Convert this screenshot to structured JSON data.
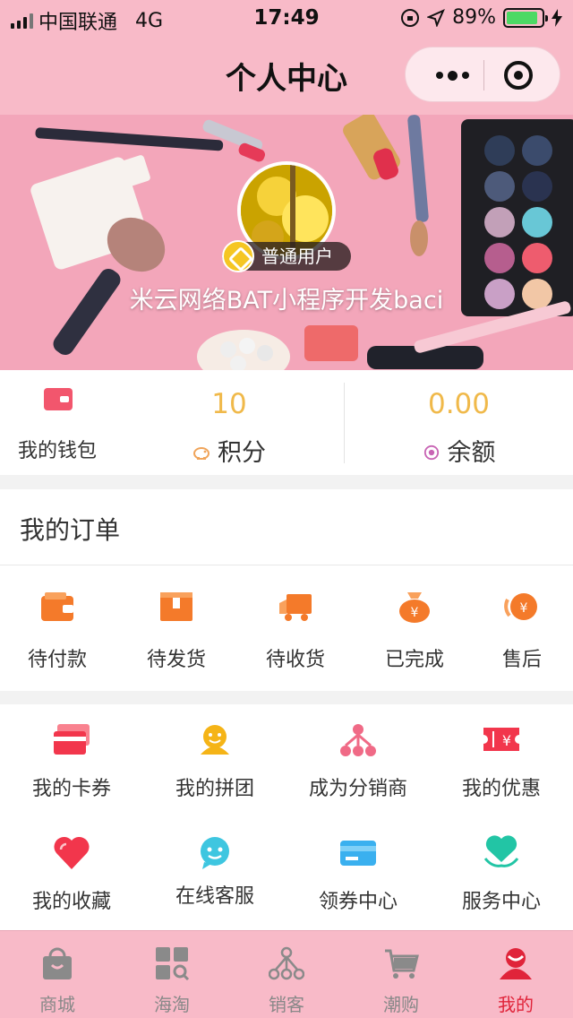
{
  "status_bar": {
    "carrier": "中国联通",
    "network": "4G",
    "time": "17:49",
    "battery": "89%",
    "battery_level": 0.89
  },
  "nav": {
    "title": "个人中心"
  },
  "profile": {
    "badge": "普通用户",
    "username": "米云网络BAT小程序开发baci"
  },
  "wallet": {
    "label": "我的钱包"
  },
  "stats": [
    {
      "value": "10",
      "label": "积分",
      "icon": "piggy-icon"
    },
    {
      "value": "0.00",
      "label": "余额",
      "icon": "coin-icon"
    }
  ],
  "orders": {
    "title": "我的订单",
    "items": [
      {
        "label": "待付款",
        "icon": "wallet-icon"
      },
      {
        "label": "待发货",
        "icon": "box-icon"
      },
      {
        "label": "待收货",
        "icon": "truck-icon"
      },
      {
        "label": "已完成",
        "icon": "money-bag-icon"
      },
      {
        "label": "售后",
        "icon": "refund-icon"
      }
    ]
  },
  "services": [
    {
      "label": "我的卡券",
      "icon": "card-icon"
    },
    {
      "label": "我的拼团",
      "icon": "group-icon"
    },
    {
      "label": "成为分销商",
      "icon": "distributor-icon"
    },
    {
      "label": "我的优惠",
      "icon": "coupon-icon"
    },
    {
      "label": "我的收藏",
      "icon": "heart-icon"
    },
    {
      "label": "在线客服",
      "icon": "chat-icon"
    },
    {
      "label": "领券中心",
      "icon": "credit-card-icon"
    },
    {
      "label": "服务中心",
      "icon": "service-heart-icon"
    }
  ],
  "tabbar": [
    {
      "label": "商城",
      "icon": "shopping-bag-icon"
    },
    {
      "label": "海淘",
      "icon": "grid-search-icon"
    },
    {
      "label": "销客",
      "icon": "network-icon"
    },
    {
      "label": "潮购",
      "icon": "cart-icon"
    },
    {
      "label": "我的",
      "icon": "user-icon",
      "active": true
    }
  ],
  "colors": {
    "pink": "#f8bac8",
    "accent_orange": "#f47a2a",
    "value_gold": "#f0b94a",
    "active_red": "#e0243a"
  }
}
